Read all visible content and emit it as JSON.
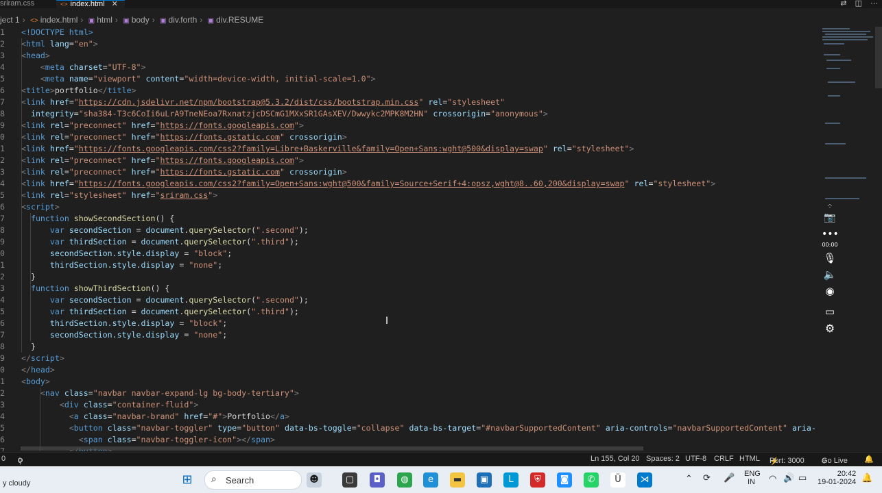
{
  "tabs": [
    {
      "label": "sriram.css"
    },
    {
      "label": "index.html"
    }
  ],
  "breadcrumb": {
    "items": [
      "ject 1",
      "index.html",
      "html",
      "body",
      "div.forth",
      "div.RESUME"
    ]
  },
  "editor": {
    "lines": [
      {
        "n": "1"
      },
      {
        "n": "2"
      },
      {
        "n": "3"
      },
      {
        "n": "4"
      },
      {
        "n": "5"
      },
      {
        "n": "6"
      },
      {
        "n": "7"
      },
      {
        "n": "8"
      },
      {
        "n": "9"
      },
      {
        "n": "0"
      },
      {
        "n": "1"
      },
      {
        "n": "2"
      },
      {
        "n": "3"
      },
      {
        "n": "4"
      },
      {
        "n": "5"
      },
      {
        "n": "6"
      },
      {
        "n": "7"
      },
      {
        "n": "8"
      },
      {
        "n": "9"
      },
      {
        "n": "0"
      },
      {
        "n": "1"
      },
      {
        "n": "2"
      },
      {
        "n": "3"
      },
      {
        "n": "4"
      },
      {
        "n": "5"
      },
      {
        "n": "6"
      },
      {
        "n": "7"
      },
      {
        "n": "8"
      },
      {
        "n": "9"
      },
      {
        "n": "0"
      },
      {
        "n": "1"
      },
      {
        "n": "2"
      },
      {
        "n": "3"
      },
      {
        "n": "4"
      },
      {
        "n": "5"
      },
      {
        "n": "6"
      },
      {
        "n": "7"
      }
    ]
  },
  "code": {
    "l1": "<!DOCTYPE html>",
    "l2a": "html",
    "l2b": "lang",
    "l2c": "\"en\"",
    "l3": "head",
    "l4a": "meta",
    "l4b": "charset",
    "l4c": "\"UTF-8\"",
    "l5a": "meta",
    "l5b": "name",
    "l5c": "\"viewport\"",
    "l5d": "content",
    "l5e": "\"width=device-width, initial-scale=1.0\"",
    "l6a": "title",
    "l6b": "portfolio",
    "l7a": "link",
    "l7b": "href",
    "l7c": "https://cdn.jsdelivr.net/npm/bootstrap@5.3.2/dist/css/bootstrap.min.css",
    "l7d": "rel",
    "l7e": "\"stylesheet\"",
    "l8a": "integrity",
    "l8b": "\"sha384-T3c6CoIi6uLrA9TneNEoa7RxnatzjcDSCmG1MXxSR1GAsXEV/Dwwykc2MPK8M2HN\"",
    "l8c": "crossorigin",
    "l8d": "\"anonymous\"",
    "l9a": "link",
    "l9b": "rel",
    "l9c": "\"preconnect\"",
    "l9d": "href",
    "l9e": "https://fonts.googleapis.com",
    "l10a": "link",
    "l10b": "rel",
    "l10c": "\"preconnect\"",
    "l10d": "href",
    "l10e": "https://fonts.gstatic.com",
    "l10f": "crossorigin",
    "l11a": "link",
    "l11b": "href",
    "l11c": "https://fonts.googleapis.com/css2?family=Libre+Baskerville&family=Open+Sans:wght@500&display=swap",
    "l11d": "rel",
    "l11e": "\"stylesheet\"",
    "l12a": "link",
    "l12b": "rel",
    "l12c": "\"preconnect\"",
    "l12d": "href",
    "l12e": "https://fonts.googleapis.com",
    "l13a": "link",
    "l13b": "rel",
    "l13c": "\"preconnect\"",
    "l13d": "href",
    "l13e": "https://fonts.gstatic.com",
    "l13f": "crossorigin",
    "l14a": "link",
    "l14b": "href",
    "l14c": "https://fonts.googleapis.com/css2?family=Open+Sans:wght@500&family=Source+Serif+4:opsz,wght@8..60,200&display=swap",
    "l14d": "rel",
    "l14e": "\"stylesheet\"",
    "l15a": "link",
    "l15b": "rel",
    "l15c": "\"stylesheet\"",
    "l15d": "href",
    "l15e": "sriram.css",
    "l16": "script",
    "l17a": "function",
    "l17b": "showSecondSection",
    "l18a": "var",
    "l18b": "secondSection",
    "l18c": "document",
    "l18d": "querySelector",
    "l18e": "\".second\"",
    "l19a": "var",
    "l19b": "thirdSection",
    "l19c": "document",
    "l19d": "querySelector",
    "l19e": "\".third\"",
    "l20a": "secondSection.style.display",
    "l20b": "\"block\"",
    "l21a": "thirdSection.style.display",
    "l21b": "\"none\"",
    "l23a": "function",
    "l23b": "showThirdSection",
    "l24a": "var",
    "l24b": "secondSection",
    "l24c": "document",
    "l24d": "querySelector",
    "l24e": "\".second\"",
    "l25a": "var",
    "l25b": "thirdSection",
    "l25c": "document",
    "l25d": "querySelector",
    "l25e": "\".third\"",
    "l26a": "thirdSection.style.display",
    "l26b": "\"block\"",
    "l27a": "secondSection.style.display",
    "l27b": "\"none\"",
    "l29": "script",
    "l30": "head",
    "l31": "body",
    "l32a": "nav",
    "l32b": "class",
    "l32c": "\"navbar navbar-expand-lg bg-body-tertiary\"",
    "l33a": "div",
    "l33b": "class",
    "l33c": "\"container-fluid\"",
    "l34a": "a",
    "l34b": "class",
    "l34c": "\"navbar-brand\"",
    "l34d": "href",
    "l34e": "\"#\"",
    "l34f": "Portfolio",
    "l35a": "button",
    "l35b": "class",
    "l35c": "\"navbar-toggler\"",
    "l35d": "type",
    "l35e": "\"button\"",
    "l35f": "data-bs-toggle",
    "l35g": "\"collapse\"",
    "l35h": "data-bs-target",
    "l35i": "\"#navbarSupportedContent\"",
    "l35j": "aria-controls",
    "l35k": "\"navbarSupportedContent\"",
    "l35l": "aria-expa",
    "l36a": "span",
    "l36b": "class",
    "l36c": "\"navbar-toggler-icon\"",
    "l37": "button"
  },
  "recorder": {
    "timer": "00:00"
  },
  "status": {
    "left0": "0",
    "ports": "0",
    "cursor": "Ln 155, Col 20",
    "spaces": "Spaces: 2",
    "encoding": "UTF-8",
    "eol": "CRLF",
    "lang": "HTML",
    "port": "Port: 3000",
    "golive": "Go Live"
  },
  "taskbar": {
    "weather": "y cloudy",
    "search": "Search",
    "lang1": "ENG",
    "lang2": "IN",
    "time": "20:42",
    "date": "19-01-2024"
  },
  "colors": {
    "accent": "#0078d4",
    "editor_bg": "#1f1f1f",
    "taskbar_bg": "#e9eef5"
  }
}
